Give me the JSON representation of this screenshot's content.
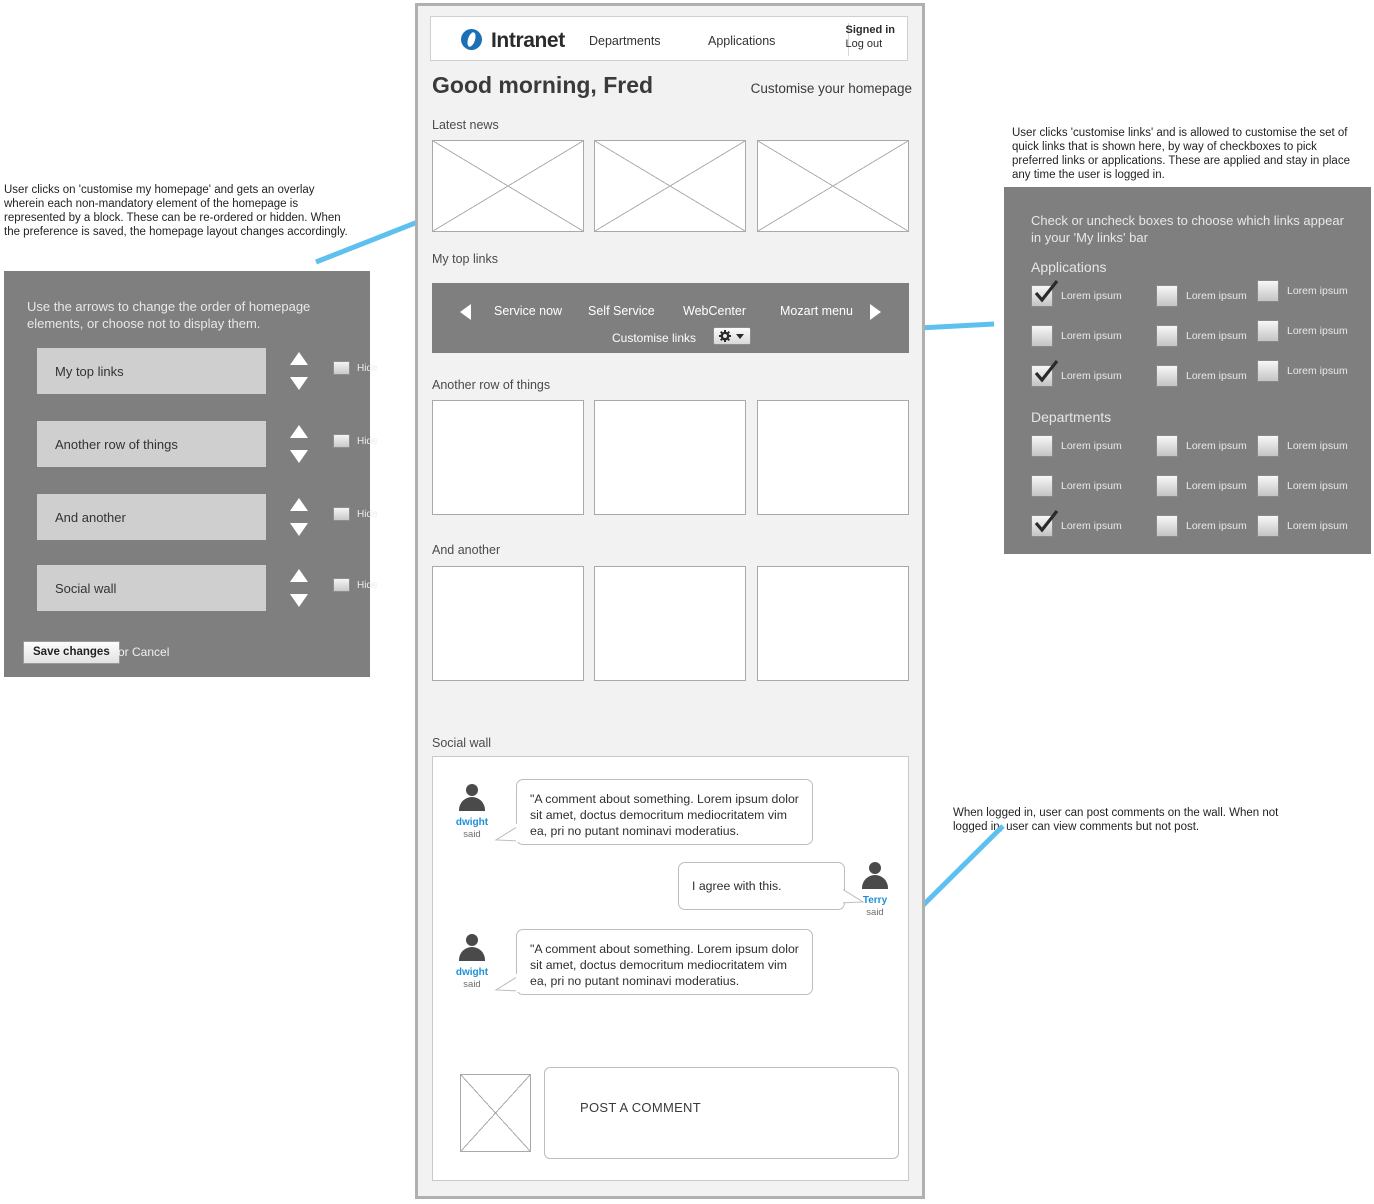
{
  "annotations": {
    "left": "User clicks on 'customise my homepage' and gets an overlay wherein each non-mandatory element of the homepage is represented by a block. These can be re-ordered or hidden. When the preference is saved, the homepage layout changes accordingly.",
    "top_right": "User clicks 'customise links' and is allowed to customise the set of quick links that is shown here, by way of checkboxes to pick preferred links or applications. These are applied and stay in place any time the user is logged in.",
    "bottom_right": "When logged in, user can post comments on the wall. When not logged in, user can view comments but not post."
  },
  "customise_homepage_overlay": {
    "instruction": "Use the arrows to change the  order of homepage elements, or choose not to display them.",
    "rows": [
      {
        "label": "My top links",
        "hide_label": "Hide",
        "hidden": false
      },
      {
        "label": "Another row of things",
        "hide_label": "Hide",
        "hidden": false
      },
      {
        "label": "And another",
        "hide_label": "Hide",
        "hidden": false
      },
      {
        "label": "Social wall",
        "hide_label": "Hide",
        "hidden": false
      }
    ],
    "save_label": "Save changes",
    "cancel_label": "or Cancel"
  },
  "customise_links_overlay": {
    "instruction": "Check or uncheck boxes to choose which links appear in your 'My links' bar",
    "groups": [
      {
        "heading": "Applications",
        "items": [
          {
            "label": "Lorem ipsum",
            "checked": true
          },
          {
            "label": "Lorem ipsum",
            "checked": false
          },
          {
            "label": "Lorem ipsum",
            "checked": false
          },
          {
            "label": "Lorem ipsum",
            "checked": false
          },
          {
            "label": "Lorem ipsum",
            "checked": false
          },
          {
            "label": "Lorem ipsum",
            "checked": false
          },
          {
            "label": "Lorem ipsum",
            "checked": true
          },
          {
            "label": "Lorem ipsum",
            "checked": false
          },
          {
            "label": "Lorem ipsum",
            "checked": false
          }
        ]
      },
      {
        "heading": "Departments",
        "items": [
          {
            "label": "Lorem ipsum",
            "checked": false
          },
          {
            "label": "Lorem ipsum",
            "checked": false
          },
          {
            "label": "Lorem ipsum",
            "checked": false
          },
          {
            "label": "Lorem ipsum",
            "checked": false
          },
          {
            "label": "Lorem ipsum",
            "checked": false
          },
          {
            "label": "Lorem ipsum",
            "checked": false
          },
          {
            "label": "Lorem ipsum",
            "checked": true
          },
          {
            "label": "Lorem ipsum",
            "checked": false
          },
          {
            "label": "Lorem ipsum",
            "checked": false
          }
        ]
      }
    ]
  },
  "page": {
    "topbar": {
      "logo_text": "Intranet",
      "nav": [
        {
          "label": "Departments"
        },
        {
          "label": "Applications"
        }
      ],
      "signed_in": "Signed in",
      "log_out": "Log out"
    },
    "greeting": "Good morning, Fred",
    "customise_homepage_link": "Customise your homepage",
    "sections": {
      "latest_news": "Latest news",
      "my_top_links": "My top links",
      "another_row": "Another row of things",
      "and_another": "And another",
      "social_wall": "Social wall"
    },
    "top_links": {
      "links": [
        "Service now",
        "Self Service",
        "WebCenter",
        "Mozart menu"
      ],
      "customise_label": "Customise links"
    },
    "social": {
      "comments": [
        {
          "author": "dwight",
          "said": "said",
          "text": "\"A comment about something. Lorem ipsum dolor sit amet, doctus democritum mediocritatem vim ea, pri no putant nominavi moderatius.",
          "side": "left"
        },
        {
          "author": "Terry",
          "said": "said",
          "text": "I agree with this.",
          "side": "right"
        },
        {
          "author": "dwight",
          "said": "said",
          "text": "\"A comment about something. Lorem ipsum dolor sit amet, doctus democritum mediocritatem vim ea, pri no putant nominavi moderatius.",
          "side": "left"
        }
      ],
      "post_placeholder": "POST A COMMENT"
    }
  },
  "colors": {
    "panel_gray": "#7f7f7f",
    "page_bg": "#f2f2f2",
    "accent_blue": "#1e90d6",
    "arrow_blue": "#5ec0ef",
    "logo_blue": "#1a6fb5"
  }
}
